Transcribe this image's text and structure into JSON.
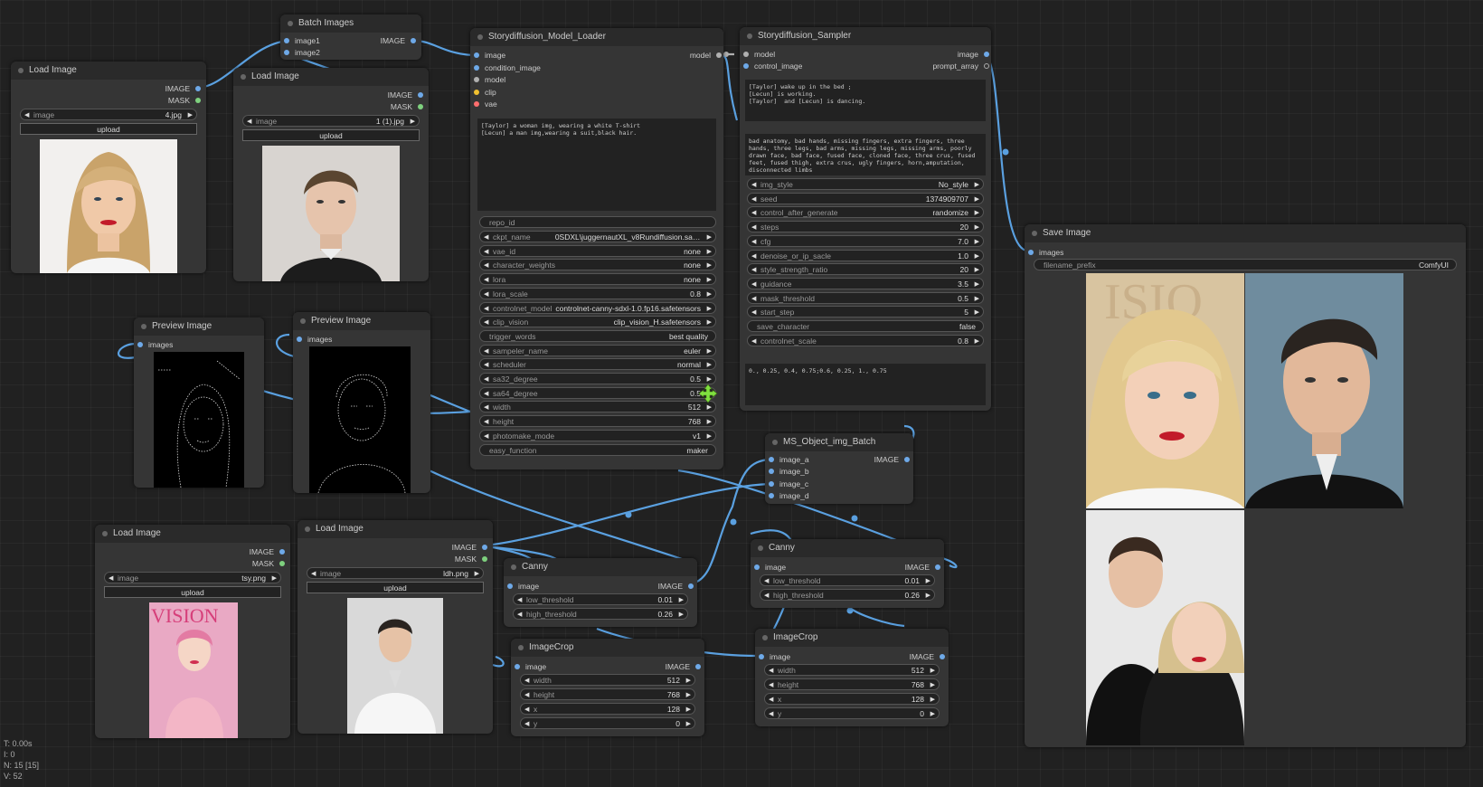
{
  "nodes": {
    "load1": {
      "title": "Load Image",
      "out_image": "IMAGE",
      "out_mask": "MASK",
      "image_label": "image",
      "image_value": "4.jpg",
      "upload": "upload"
    },
    "batch": {
      "title": "Batch Images",
      "in1": "image1",
      "in2": "image2",
      "out": "IMAGE"
    },
    "load2": {
      "title": "Load Image",
      "out_image": "IMAGE",
      "out_mask": "MASK",
      "image_label": "image",
      "image_value": "1 (1).jpg",
      "upload": "upload"
    },
    "model_loader": {
      "title": "Storydiffusion_Model_Loader",
      "inputs": [
        "image",
        "condition_image",
        "model",
        "clip",
        "vae"
      ],
      "out": "model",
      "prompt": "[Taylor] a woman img, wearing a white T-shirt\n[Lecun] a man img,wearing a suit,black hair.",
      "repo_id": "repo_id",
      "widgets": [
        {
          "label": "ckpt_name",
          "value": "0SDXL\\juggernautXL_v8Rundiffusion.safetens..."
        },
        {
          "label": "vae_id",
          "value": "none"
        },
        {
          "label": "character_weights",
          "value": "none"
        },
        {
          "label": "lora",
          "value": "none"
        },
        {
          "label": "lora_scale",
          "value": "0.8"
        },
        {
          "label": "controlnet_model",
          "value": "controlnet-canny-sdxl-1.0.fp16.safetensors"
        },
        {
          "label": "clip_vision",
          "value": "clip_vision_H.safetensors"
        }
      ],
      "trigger_words": {
        "label": "trigger_words",
        "value": "best quality"
      },
      "widgets2": [
        {
          "label": "sampeler_name",
          "value": "euler"
        },
        {
          "label": "scheduler",
          "value": "normal"
        },
        {
          "label": "sa32_degree",
          "value": "0.5"
        },
        {
          "label": "sa64_degree",
          "value": "0.5"
        },
        {
          "label": "width",
          "value": "512"
        },
        {
          "label": "height",
          "value": "768"
        },
        {
          "label": "photomake_mode",
          "value": "v1"
        }
      ],
      "easy_function": {
        "label": "easy_function",
        "value": "maker"
      }
    },
    "sampler": {
      "title": "Storydiffusion_Sampler",
      "in_model": "model",
      "in_control": "control_image",
      "out_image": "image",
      "out_prompt": "prompt_array",
      "prompt": "[Taylor] wake up in the bed ;\n[Lecun] is working.\n[Taylor]  and [Lecun] is dancing.",
      "negative": "bad anatomy, bad hands, missing fingers, extra fingers, three hands, three legs, bad arms, missing legs, missing arms, poorly drawn face, bad face, fused face, cloned face, three crus, fused feet, fused thigh, extra crus, ugly fingers, horn,amputation, disconnected limbs",
      "widgets": [
        {
          "label": "img_style",
          "value": "No_style"
        },
        {
          "label": "seed",
          "value": "1374909707"
        },
        {
          "label": "control_after_generate",
          "value": "randomize"
        },
        {
          "label": "steps",
          "value": "20"
        },
        {
          "label": "cfg",
          "value": "7.0"
        },
        {
          "label": "denoise_or_ip_sacle",
          "value": "1.0"
        },
        {
          "label": "style_strength_ratio",
          "value": "20"
        },
        {
          "label": "guidance",
          "value": "3.5"
        },
        {
          "label": "mask_threshold",
          "value": "0.5"
        },
        {
          "label": "start_step",
          "value": "5"
        }
      ],
      "save_character": {
        "label": "save_character",
        "value": "false"
      },
      "controlnet_scale": {
        "label": "controlnet_scale",
        "value": "0.8"
      },
      "bottom_text": "0., 0.25, 0.4, 0.75;0.6, 0.25, 1., 0.75"
    },
    "save": {
      "title": "Save Image",
      "in": "images",
      "prefix_label": "filename_prefix",
      "prefix_value": "ComfyUI"
    },
    "preview1": {
      "title": "Preview Image",
      "in": "images"
    },
    "preview2": {
      "title": "Preview Image",
      "in": "images"
    },
    "ms_batch": {
      "title": "MS_Object_img_Batch",
      "inputs": [
        "image_a",
        "image_b",
        "image_c",
        "image_d"
      ],
      "out": "IMAGE"
    },
    "load3": {
      "title": "Load Image",
      "out_image": "IMAGE",
      "out_mask": "MASK",
      "image_label": "image",
      "image_value": "tsy.png",
      "upload": "upload",
      "poster_text": "VISION"
    },
    "load4": {
      "title": "Load Image",
      "out_image": "IMAGE",
      "out_mask": "MASK",
      "image_label": "image",
      "image_value": "ldh.png",
      "upload": "upload"
    },
    "canny1": {
      "title": "Canny",
      "in": "image",
      "out": "IMAGE",
      "widgets": [
        {
          "label": "low_threshold",
          "value": "0.01"
        },
        {
          "label": "high_threshold",
          "value": "0.26"
        }
      ]
    },
    "canny2": {
      "title": "Canny",
      "in": "image",
      "out": "IMAGE",
      "widgets": [
        {
          "label": "low_threshold",
          "value": "0.01"
        },
        {
          "label": "high_threshold",
          "value": "0.26"
        }
      ]
    },
    "crop1": {
      "title": "ImageCrop",
      "in": "image",
      "out": "IMAGE",
      "widgets": [
        {
          "label": "width",
          "value": "512"
        },
        {
          "label": "height",
          "value": "768"
        },
        {
          "label": "x",
          "value": "128"
        },
        {
          "label": "y",
          "value": "0"
        }
      ]
    },
    "crop2": {
      "title": "ImageCrop",
      "in": "image",
      "out": "IMAGE",
      "widgets": [
        {
          "label": "width",
          "value": "512"
        },
        {
          "label": "height",
          "value": "768"
        },
        {
          "label": "x",
          "value": "128"
        },
        {
          "label": "y",
          "value": "0"
        }
      ]
    }
  },
  "stats": {
    "t": "T: 0.00s",
    "i": "I: 0",
    "n": "N: 15 [15]",
    "v": "V: 52"
  },
  "colors": {
    "background": "#212121",
    "node": "#353535",
    "link": "#5aa0e0",
    "model_slot": "#b0b0b0",
    "clip_slot": "#f0c030",
    "vae_slot": "#ff6e6e",
    "mask_slot": "#7ed07e",
    "cursor": "#80e040"
  }
}
